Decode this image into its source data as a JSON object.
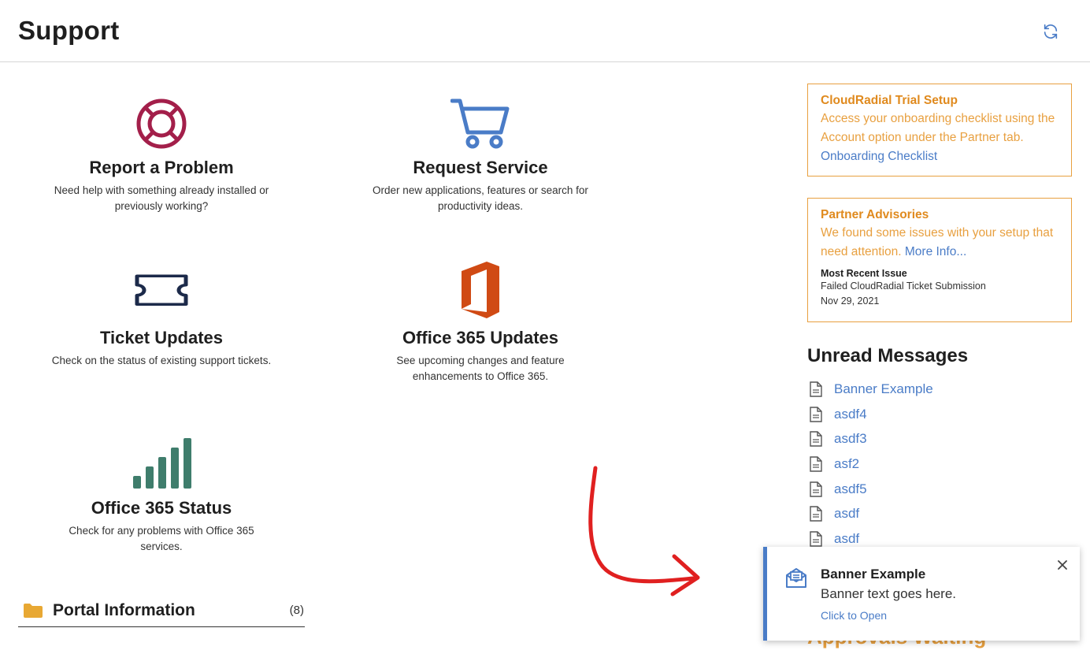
{
  "header": {
    "title": "Support",
    "refresh_icon": "refresh-icon"
  },
  "tiles": [
    {
      "title": "Report a Problem",
      "desc": "Need help with something already installed or previously working?",
      "icon": "lifebuoy-icon",
      "color": "#a31f4a"
    },
    {
      "title": "Request Service",
      "desc": "Order new applications, features or search for productivity ideas.",
      "icon": "shopping-cart-icon",
      "color": "#4a7cc7"
    },
    {
      "title": "Ticket Updates",
      "desc": "Check on the status of existing support tickets.",
      "icon": "ticket-icon",
      "color": "#1c2a4a"
    },
    {
      "title": "Office 365 Updates",
      "desc": "See upcoming changes and feature enhancements to Office 365.",
      "icon": "office-logo-icon",
      "color": "#d04a14"
    },
    {
      "title": "Office 365 Status",
      "desc": "Check for any problems with Office 365 services.",
      "icon": "signal-bars-icon",
      "color": "#3f7d6c"
    }
  ],
  "cards": {
    "trial": {
      "title": "CloudRadial Trial Setup",
      "text": "Access your onboarding checklist using the Account option under the Partner tab.",
      "link": "Onboarding Checklist"
    },
    "advisories": {
      "title": "Partner Advisories",
      "text": "We found some issues with your setup that need attention.",
      "link": "More Info...",
      "recent_label": "Most Recent Issue",
      "recent_issue": "Failed CloudRadial Ticket Submission",
      "recent_date": "Nov 29, 2021"
    },
    "accent_color": "#e8a040"
  },
  "unread_messages": {
    "heading": "Unread Messages",
    "items": [
      "Banner Example",
      "asdf4",
      "asdf3",
      "asf2",
      "asdf5",
      "asdf",
      "asdf"
    ]
  },
  "approvals": {
    "heading": "Approvals Waiting"
  },
  "toast": {
    "title": "Banner Example",
    "text": "Banner text goes here.",
    "link": "Click to Open",
    "icon": "mail-open-icon",
    "close_icon": "close-icon"
  },
  "folders": [
    {
      "label": "Portal Information",
      "count": "(8)",
      "icon": "folder-icon"
    }
  ],
  "annotation": {
    "arrow": "red-arrow-annotation",
    "color": "#e02020"
  },
  "link_color": "#4a7cc7"
}
